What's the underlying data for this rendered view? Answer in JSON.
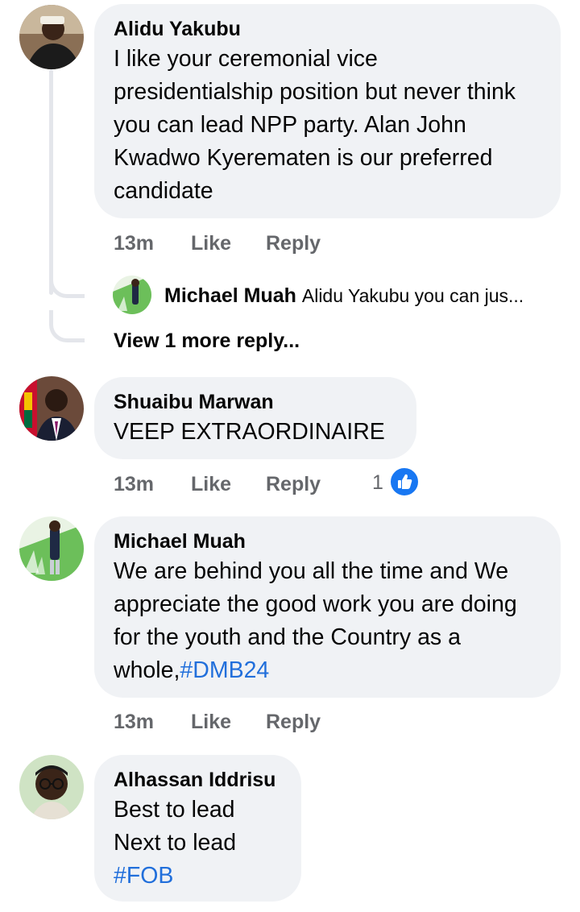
{
  "comments": [
    {
      "author": "Alidu Yakubu",
      "text": "I like your ceremonial vice presidentialship position but never think you can lead NPP party. Alan John Kwadwo Kyerematen is our preferred candidate",
      "time": "13m",
      "like": "Like",
      "reply": "Reply",
      "nested_reply": {
        "author": "Michael Muah",
        "preview": "Alidu Yakubu you can jus..."
      },
      "view_more": "View 1 more reply..."
    },
    {
      "author": "Shuaibu Marwan",
      "text": "VEEP EXTRAORDINAIRE",
      "time": "13m",
      "like": "Like",
      "reply": "Reply",
      "reaction_count": "1",
      "reaction_icon": "thumbs-up-icon"
    },
    {
      "author": "Michael Muah",
      "text": "We are behind you all the time and We appreciate the good work you are doing for the youth and the Country as a whole,",
      "hashtag": "#DMB24",
      "time": "13m",
      "like": "Like",
      "reply": "Reply"
    },
    {
      "author": "Alhassan Iddrisu",
      "line1": "Best to lead",
      "line2": "Next to lead",
      "hashtag": "#FOB"
    }
  ],
  "colors": {
    "bubble": "#f0f2f5",
    "meta_text": "#65676b",
    "hashtag": "#216fdb",
    "like_badge": "#1877f2"
  }
}
